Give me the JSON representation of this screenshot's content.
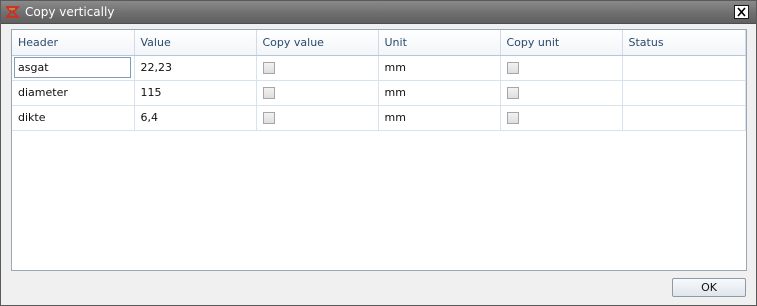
{
  "window": {
    "title": "Copy vertically",
    "close_label": "X"
  },
  "grid": {
    "columns": [
      "Header",
      "Value",
      "Copy value",
      "Unit",
      "Copy unit",
      "Status"
    ],
    "rows": [
      {
        "header": "asgat",
        "value": "22,23",
        "copy_value": false,
        "unit": "mm",
        "copy_unit": false,
        "status": ""
      },
      {
        "header": "diameter",
        "value": "115",
        "copy_value": false,
        "unit": "mm",
        "copy_unit": false,
        "status": ""
      },
      {
        "header": "dikte",
        "value": "6,4",
        "copy_value": false,
        "unit": "mm",
        "copy_unit": false,
        "status": ""
      }
    ]
  },
  "footer": {
    "ok_label": "OK"
  },
  "icons": {
    "title_icon": "app-logo-icon",
    "close_icon": "close-icon",
    "checkbox": "checkbox-unchecked"
  },
  "colors": {
    "titlebar": "#6f6f6f",
    "grid_border": "#9ba7b4",
    "header_text": "#2b4a6b",
    "logo_red": "#d62c1a"
  }
}
